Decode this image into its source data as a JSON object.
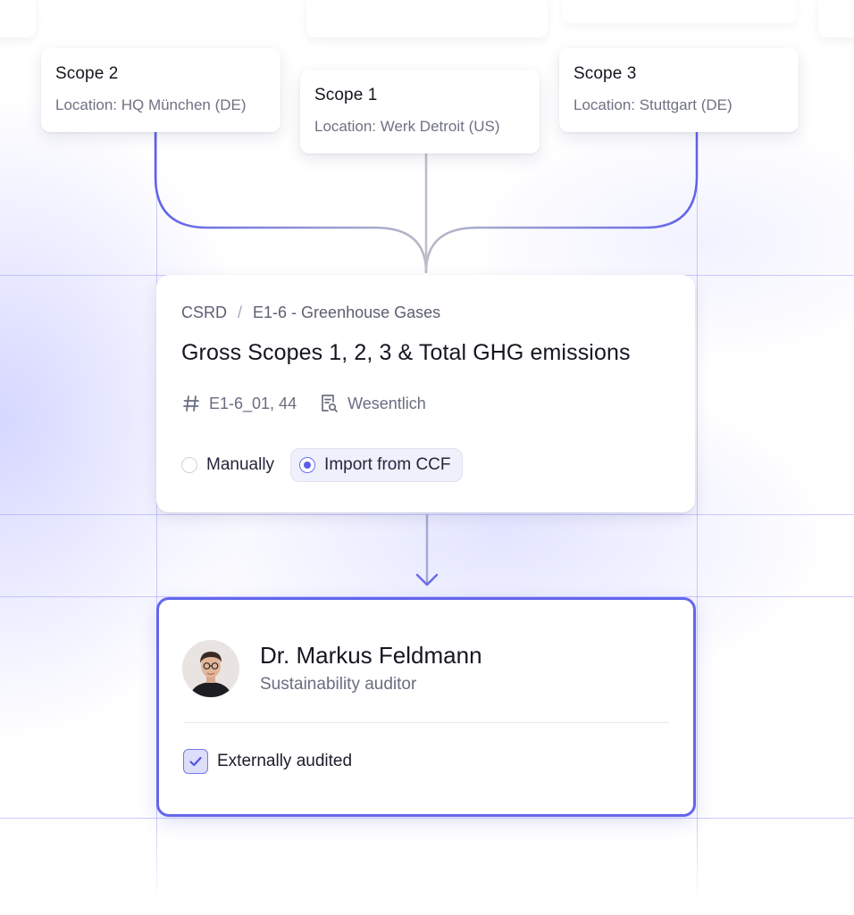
{
  "scopes": [
    {
      "title": "Scope 2",
      "location": "Location: HQ München (DE)"
    },
    {
      "title": "Scope 1",
      "location": "Location: Werk Detroit (US)"
    },
    {
      "title": "Scope 3",
      "location": "Location: Stuttgart (DE)"
    }
  ],
  "datapoint": {
    "breadcrumb": [
      "CSRD",
      "E1-6 - Greenhouse Gases"
    ],
    "breadcrumb_separator": "/",
    "title": "Gross Scopes 1, 2, 3 & Total GHG emissions",
    "reference": "E1-6_01, 44",
    "reference_icon": "hash-icon",
    "materiality": "Wesentlich",
    "materiality_icon": "document-search-icon",
    "options": [
      {
        "label": "Manually",
        "selected": false
      },
      {
        "label": "Import from CCF",
        "selected": true
      }
    ]
  },
  "auditor": {
    "name": "Dr. Markus Feldmann",
    "role": "Sustainability auditor",
    "audit_label": "Externally audited",
    "audited": true
  },
  "colors": {
    "accent": "#6466ec",
    "connector_gray": "#b8b9c4",
    "grid": "#a0a2ff"
  }
}
